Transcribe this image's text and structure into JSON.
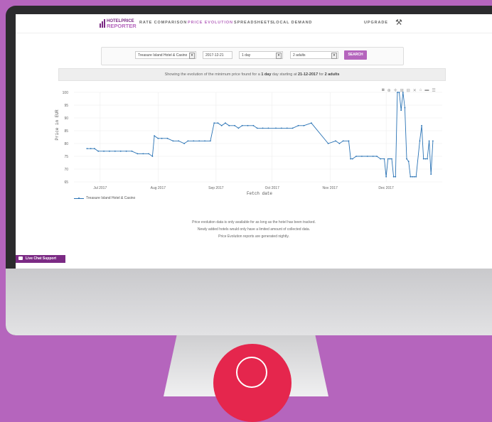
{
  "nav": {
    "brand_line1": "HOTELPRICE",
    "brand_line2": "REPORTER",
    "items": [
      "RATE COMPARISON",
      "PRICE EVOLUTION",
      "SPREADSHEETS",
      "LOCAL DEMAND"
    ],
    "upgrade": "UPGRADE",
    "tools_icon": "tools-icon"
  },
  "search": {
    "hotel": "Treasure Island Hotel & Casino",
    "date": "2017-12-21",
    "duration": "1 day",
    "guests": "2 adults",
    "button": "SEARCH"
  },
  "banner": {
    "prefix": "Showing the evolution of the minimum price found for a ",
    "duration": "1 day",
    "middle": " day starting at ",
    "date": "21-12-2017",
    "for": " for ",
    "guests": "2 adults"
  },
  "chart_data": {
    "type": "line",
    "xlabel": "Fetch date",
    "ylabel": "Price in EUR",
    "ylim": [
      65,
      100
    ],
    "yticks": [
      "100",
      "95",
      "90",
      "85",
      "80",
      "75",
      "70",
      "65"
    ],
    "xtick_labels": [
      "Jul 2017",
      "Aug 2017",
      "Sep 2017",
      "Oct 2017",
      "Nov 2017",
      "Dec 2017"
    ],
    "xtick_dates": [
      "2017-07-01",
      "2017-08-01",
      "2017-09-01",
      "2017-10-01",
      "2017-11-01",
      "2017-12-01"
    ],
    "series": [
      {
        "name": "Treasure Island Hotel & Casino",
        "color": "#2a73b5",
        "points": [
          [
            "2017-06-24",
            78
          ],
          [
            "2017-06-26",
            78
          ],
          [
            "2017-06-28",
            78
          ],
          [
            "2017-06-30",
            77
          ],
          [
            "2017-07-03",
            77
          ],
          [
            "2017-07-06",
            77
          ],
          [
            "2017-07-09",
            77
          ],
          [
            "2017-07-12",
            77
          ],
          [
            "2017-07-15",
            77
          ],
          [
            "2017-07-18",
            77
          ],
          [
            "2017-07-21",
            76
          ],
          [
            "2017-07-24",
            76
          ],
          [
            "2017-07-27",
            76
          ],
          [
            "2017-07-29",
            75
          ],
          [
            "2017-07-30",
            83
          ],
          [
            "2017-08-01",
            82
          ],
          [
            "2017-08-03",
            82
          ],
          [
            "2017-08-06",
            82
          ],
          [
            "2017-08-09",
            81
          ],
          [
            "2017-08-12",
            81
          ],
          [
            "2017-08-15",
            80
          ],
          [
            "2017-08-17",
            81
          ],
          [
            "2017-08-20",
            81
          ],
          [
            "2017-08-23",
            81
          ],
          [
            "2017-08-26",
            81
          ],
          [
            "2017-08-29",
            81
          ],
          [
            "2017-08-31",
            88
          ],
          [
            "2017-09-02",
            88
          ],
          [
            "2017-09-04",
            87
          ],
          [
            "2017-09-06",
            88
          ],
          [
            "2017-09-08",
            87
          ],
          [
            "2017-09-11",
            87
          ],
          [
            "2017-09-13",
            86
          ],
          [
            "2017-09-15",
            87
          ],
          [
            "2017-09-18",
            87
          ],
          [
            "2017-09-21",
            87
          ],
          [
            "2017-09-23",
            86
          ],
          [
            "2017-09-26",
            86
          ],
          [
            "2017-09-29",
            86
          ],
          [
            "2017-10-03",
            86
          ],
          [
            "2017-10-06",
            86
          ],
          [
            "2017-10-09",
            86
          ],
          [
            "2017-10-12",
            86
          ],
          [
            "2017-10-15",
            87
          ],
          [
            "2017-10-18",
            87
          ],
          [
            "2017-10-22",
            88
          ],
          [
            "2017-10-31",
            80
          ],
          [
            "2017-11-04",
            81
          ],
          [
            "2017-11-06",
            80
          ],
          [
            "2017-11-08",
            81
          ],
          [
            "2017-11-11",
            81
          ],
          [
            "2017-11-12",
            74
          ],
          [
            "2017-11-13",
            74
          ],
          [
            "2017-11-15",
            75
          ],
          [
            "2017-11-18",
            75
          ],
          [
            "2017-11-21",
            75
          ],
          [
            "2017-11-24",
            75
          ],
          [
            "2017-11-26",
            75
          ],
          [
            "2017-11-28",
            74
          ],
          [
            "2017-11-30",
            74
          ],
          [
            "2017-12-01",
            67
          ],
          [
            "2017-12-02",
            74
          ],
          [
            "2017-12-03",
            74
          ],
          [
            "2017-12-04",
            74
          ],
          [
            "2017-12-05",
            67
          ],
          [
            "2017-12-06",
            67
          ],
          [
            "2017-12-07",
            100
          ],
          [
            "2017-12-08",
            100
          ],
          [
            "2017-12-09",
            93
          ],
          [
            "2017-12-10",
            100
          ],
          [
            "2017-12-11",
            94
          ],
          [
            "2017-12-12",
            74
          ],
          [
            "2017-12-13",
            73
          ],
          [
            "2017-12-14",
            67
          ],
          [
            "2017-12-15",
            67
          ],
          [
            "2017-12-16",
            67
          ],
          [
            "2017-12-17",
            67
          ],
          [
            "2017-12-19",
            81
          ],
          [
            "2017-12-20",
            87
          ],
          [
            "2017-12-21",
            74
          ],
          [
            "2017-12-22",
            74
          ],
          [
            "2017-12-23",
            74
          ],
          [
            "2017-12-24",
            81
          ],
          [
            "2017-12-25",
            68
          ],
          [
            "2017-12-26",
            81
          ]
        ]
      }
    ],
    "grid": true,
    "legend_position": "bottom-left"
  },
  "notes": [
    "Price evolution data is only available for as long as the hotel has been tracked.",
    "Newly added hotels would only have a limited amount of collected data.",
    "Price Evolution reports are generated nightly."
  ],
  "chat": "Live Chat Support"
}
